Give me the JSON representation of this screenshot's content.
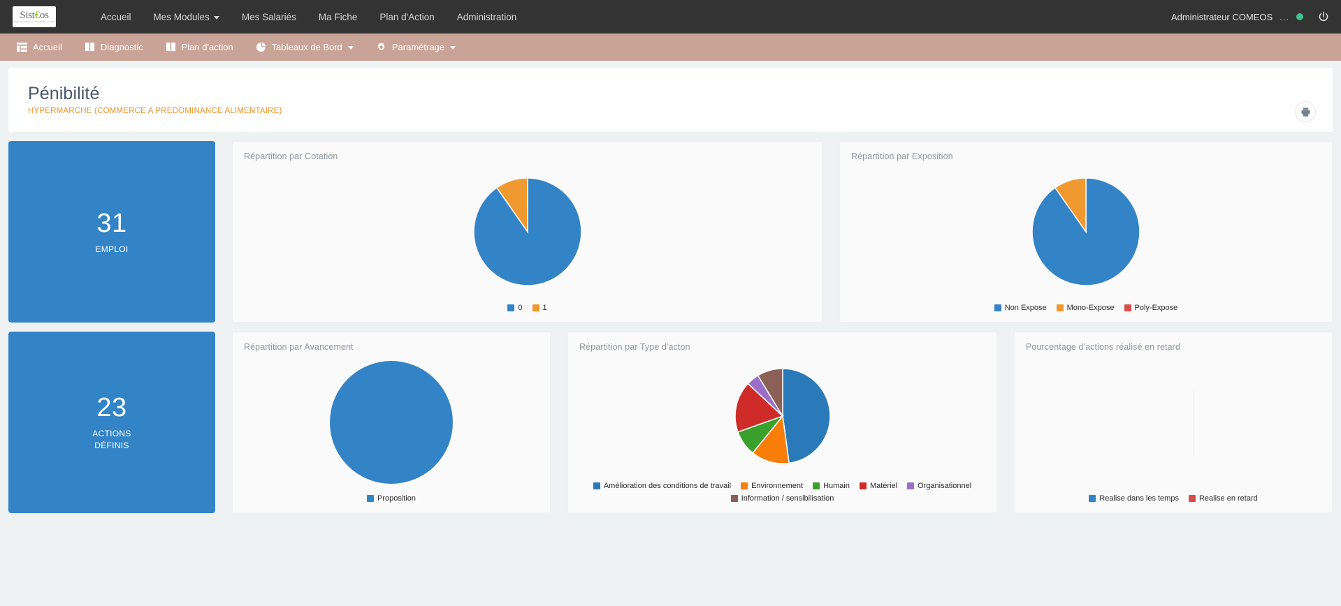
{
  "topbar": {
    "logo": {
      "text": "Sist",
      "accent": "€",
      "text2": "os",
      "tagline": "société intermédiaire pour la solidarité en France"
    },
    "nav": [
      {
        "label": "Accueil",
        "has_caret": false,
        "name": "accueil"
      },
      {
        "label": "Mes Modules",
        "has_caret": true,
        "name": "mes-modules"
      },
      {
        "label": "Mes Salariés",
        "has_caret": false,
        "name": "mes-salaries"
      },
      {
        "label": "Ma Fiche",
        "has_caret": false,
        "name": "ma-fiche"
      },
      {
        "label": "Plan d'Action",
        "has_caret": false,
        "name": "plan-daction"
      },
      {
        "label": "Administration",
        "has_caret": false,
        "name": "administration"
      }
    ],
    "user": "Administrateur COMEOS",
    "user_dots": "...",
    "status_color": "#3ec28f",
    "power_icon": "power-icon"
  },
  "subbar": {
    "bg_color": "#c9a396",
    "items": [
      {
        "label": "Accueil",
        "icon": "table-icon",
        "has_caret": false
      },
      {
        "label": "Diagnostic",
        "icon": "book-icon",
        "has_caret": false
      },
      {
        "label": "Plan d'action",
        "icon": "book-icon",
        "has_caret": false
      },
      {
        "label": "Tableaux de Bord",
        "icon": "pie-chart-icon",
        "has_caret": true
      },
      {
        "label": "Paramétrage",
        "icon": "gear-icon",
        "has_caret": true
      }
    ]
  },
  "header": {
    "title": "Pénibilité",
    "subtitle": "HYPERMARCHE (COMMERCE A PREDOMINANCE ALIMENTAIRE)",
    "subtitle_color": "#f0932b",
    "print_label": "print-icon"
  },
  "kpis": [
    {
      "value": "31",
      "label": "EMPLOI",
      "color": "#3384c6"
    },
    {
      "value": "23",
      "label": "ACTIONS\nDÉFINIS",
      "label_line1": "ACTIONS",
      "label_line2": "DÉFINIS",
      "color": "#3384c6"
    }
  ],
  "chart_data": [
    {
      "id": "cotation",
      "type": "pie",
      "title": "Répartition par Cotation",
      "categories": [
        "0",
        "1"
      ],
      "values": [
        90.3,
        9.7
      ],
      "colors": [
        "#3384c6",
        "#f0992e"
      ],
      "legend_position": "bottom",
      "radius": 77
    },
    {
      "id": "exposition",
      "type": "pie",
      "title": "Répartition par Exposition",
      "categories": [
        "Non Expose",
        "Mono-Expose",
        "Poly-Expose"
      ],
      "values": [
        90.3,
        9.7,
        0
      ],
      "colors": [
        "#3384c6",
        "#f0992e",
        "#d94c4c"
      ],
      "legend_position": "bottom",
      "radius": 77
    },
    {
      "id": "avancement",
      "type": "pie",
      "title": "Répartition par Avancement",
      "categories": [
        "Proposition"
      ],
      "values": [
        100
      ],
      "colors": [
        "#3384c6"
      ],
      "legend_position": "bottom",
      "radius": 88
    },
    {
      "id": "type-action",
      "type": "pie",
      "title": "Répartition par Type d'acton",
      "categories": [
        "Amélioration des conditions de travail",
        "Environnement",
        "Humain",
        "Matériel",
        "Organisationnel",
        "Information / sensibilisation"
      ],
      "values": [
        47.8,
        13.0,
        8.7,
        17.4,
        4.3,
        8.7
      ],
      "colors": [
        "#2a7ab9",
        "#f97d09",
        "#3aa02c",
        "#cf2b28",
        "#9b6fc9",
        "#8c6056"
      ],
      "legend_position": "bottom",
      "radius": 68
    },
    {
      "id": "retard",
      "type": "pie",
      "title": "Pourcentage d'actions réalisé en retard",
      "categories": [
        "Realise dans les temps",
        "Realise en retard"
      ],
      "values": [
        0,
        0
      ],
      "colors": [
        "#3384c6",
        "#d94c4c"
      ],
      "legend_position": "bottom",
      "empty": true,
      "radius": 0
    }
  ]
}
